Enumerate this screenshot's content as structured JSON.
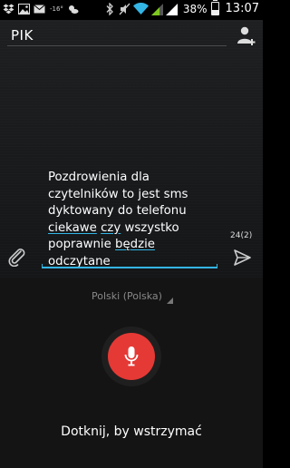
{
  "status_bar": {
    "temperature": "-16°",
    "battery_percent": "38%",
    "battery_level": 0.38,
    "time": "13:07",
    "icons": [
      "dropbox-icon",
      "image-icon",
      "email-icon",
      "weather-icon",
      "bluetooth-icon",
      "mute-icon",
      "wifi-icon",
      "signal-icon",
      "signal-icon",
      "battery-icon"
    ]
  },
  "recipient": {
    "value": "PIK"
  },
  "message": {
    "line1": "Pozdrowienia dla",
    "line2": "czytelników to jest sms",
    "line3": "dyktowany do telefonu",
    "w_ciekawe": "ciekawe",
    "w_czy": "czy",
    "w_wszystko": "wszystko",
    "w_poprawnie": "poprawnie",
    "w_bedzie": "będzie",
    "w_odczytane": "odczytane"
  },
  "counter": "24(2)",
  "voice_input": {
    "language": "Polski (Polska)",
    "hint": "Dotknij, by wstrzymać"
  },
  "colors": {
    "accent": "#33b5e5",
    "mic": "#e53935"
  }
}
